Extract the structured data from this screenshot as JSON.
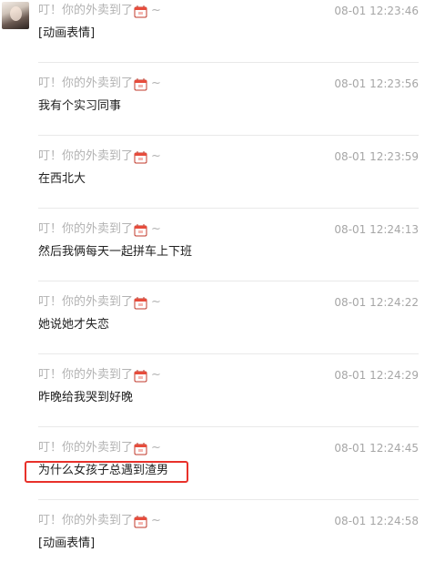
{
  "chat": {
    "sender_name": "叮！你的外卖到了",
    "sender_suffix": "~",
    "sender_icon": "takeout-box-icon",
    "messages": [
      {
        "time": "08-01 12:23:46",
        "text": "[动画表情]",
        "show_avatar": true
      },
      {
        "time": "08-01 12:23:56",
        "text": "我有个实习同事"
      },
      {
        "time": "08-01 12:23:59",
        "text": "在西北大"
      },
      {
        "time": "08-01 12:24:13",
        "text": "然后我俩每天一起拼车上下班"
      },
      {
        "time": "08-01 12:24:22",
        "text": "她说她才失恋"
      },
      {
        "time": "08-01 12:24:29",
        "text": "昨晚给我哭到好晚"
      },
      {
        "time": "08-01 12:24:45",
        "text": "为什么女孩子总遇到渣男",
        "highlighted": true
      },
      {
        "time": "08-01 12:24:58",
        "text": "[动画表情]"
      }
    ]
  },
  "colors": {
    "highlight_border": "#e8312a",
    "sender_text": "#b3b3b3",
    "message_text": "#222222",
    "divider": "#e9e9e9"
  }
}
